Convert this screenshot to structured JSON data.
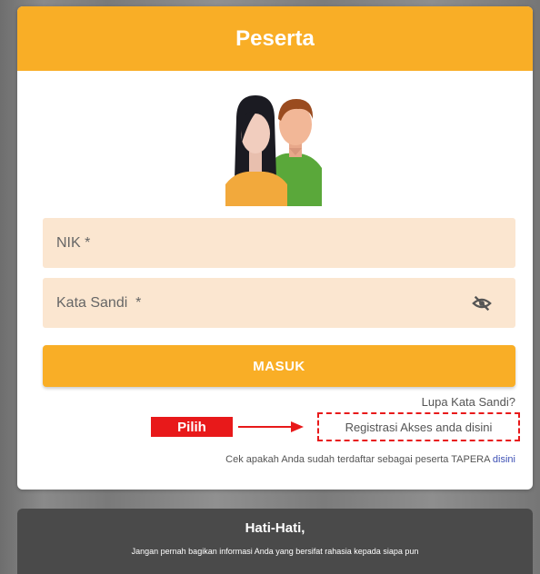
{
  "card": {
    "title": "Peserta"
  },
  "form": {
    "nik_placeholder": "NIK *",
    "password_placeholder": "Kata Sandi  *",
    "login_label": "MASUK"
  },
  "links": {
    "forgot_password": "Lupa Kata Sandi?",
    "register": "Registrasi Akses anda disini",
    "check_text": "Cek apakah Anda sudah terdaftar sebagai peserta TAPERA",
    "check_link": "disini"
  },
  "annotation": {
    "label": "Pilih"
  },
  "warning": {
    "title": "Hati-Hati,",
    "text": "Jangan pernah bagikan informasi Anda yang bersifat rahasia kepada siapa pun"
  },
  "colors": {
    "accent": "#f9ae26",
    "field_bg": "#fbe6d0",
    "highlight": "#e8191a",
    "warning_bg": "#4a4a4a"
  },
  "icons": {
    "password_toggle": "eye-slash-icon",
    "avatar": "people-avatar-icon",
    "arrow": "arrow-right-icon"
  }
}
